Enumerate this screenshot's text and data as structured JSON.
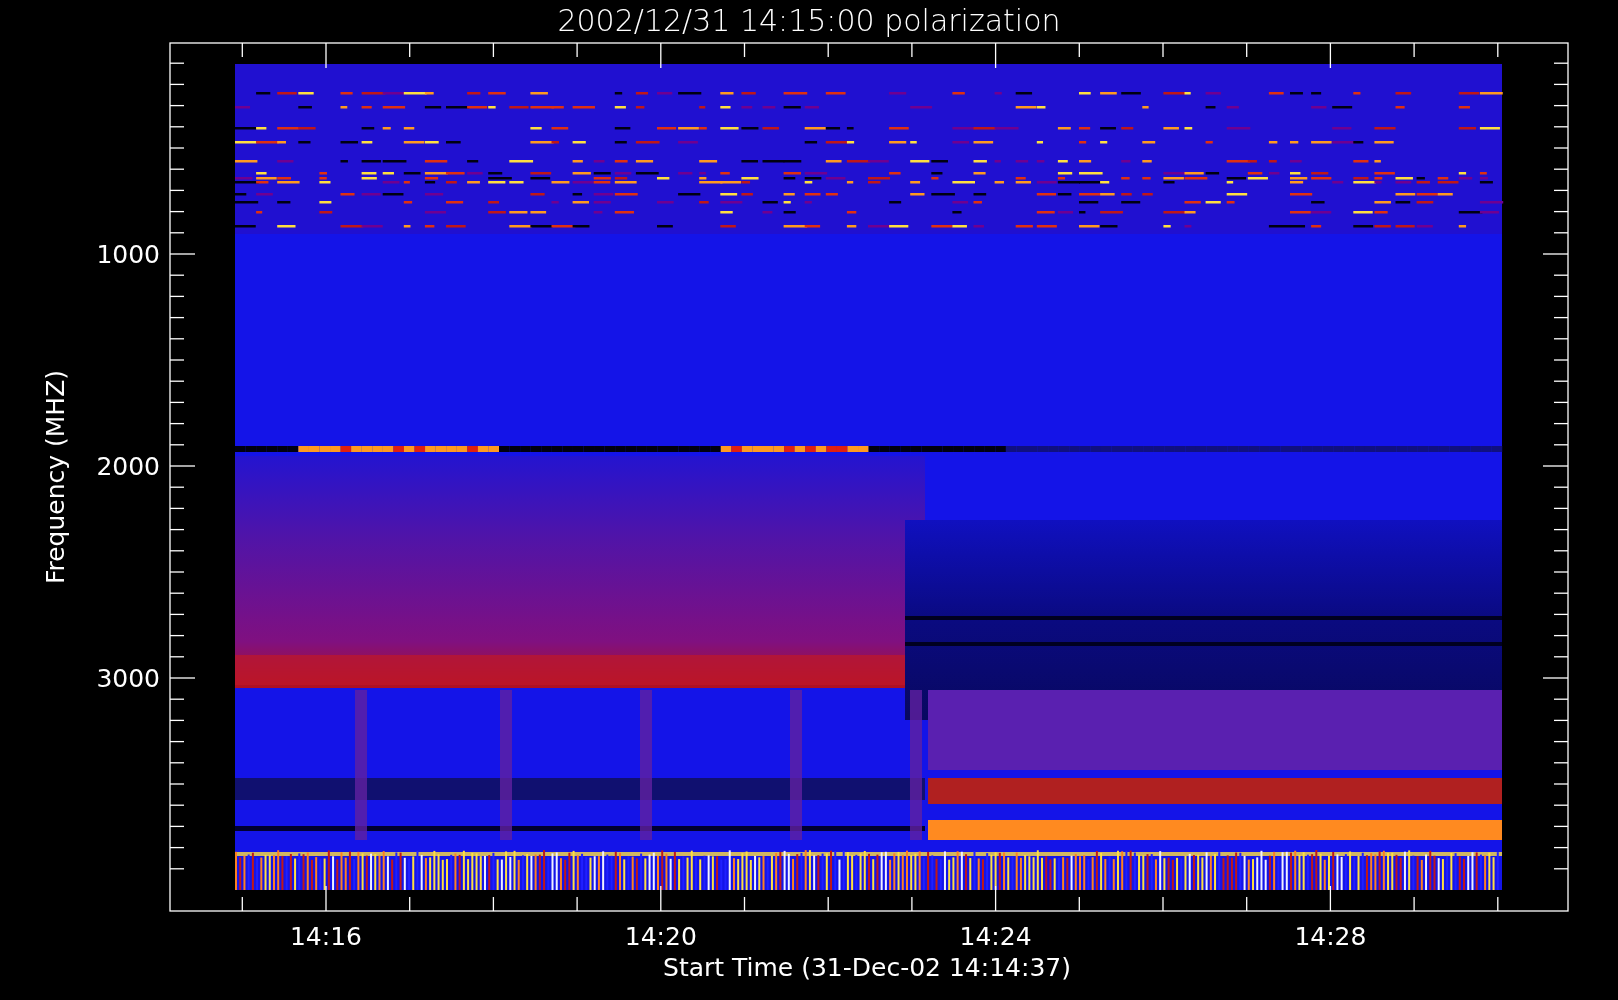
{
  "plot": {
    "title": "2002/12/31 14:15:00 polarization",
    "ylabel": "Frequency (MHZ)",
    "xlabel": "Start Time (31-Dec-02 14:14:37)",
    "y_tick_labels": [
      "1000",
      "2000",
      "3000"
    ],
    "x_tick_labels": [
      "14:16",
      "14:20",
      "14:24",
      "14:28"
    ]
  }
}
